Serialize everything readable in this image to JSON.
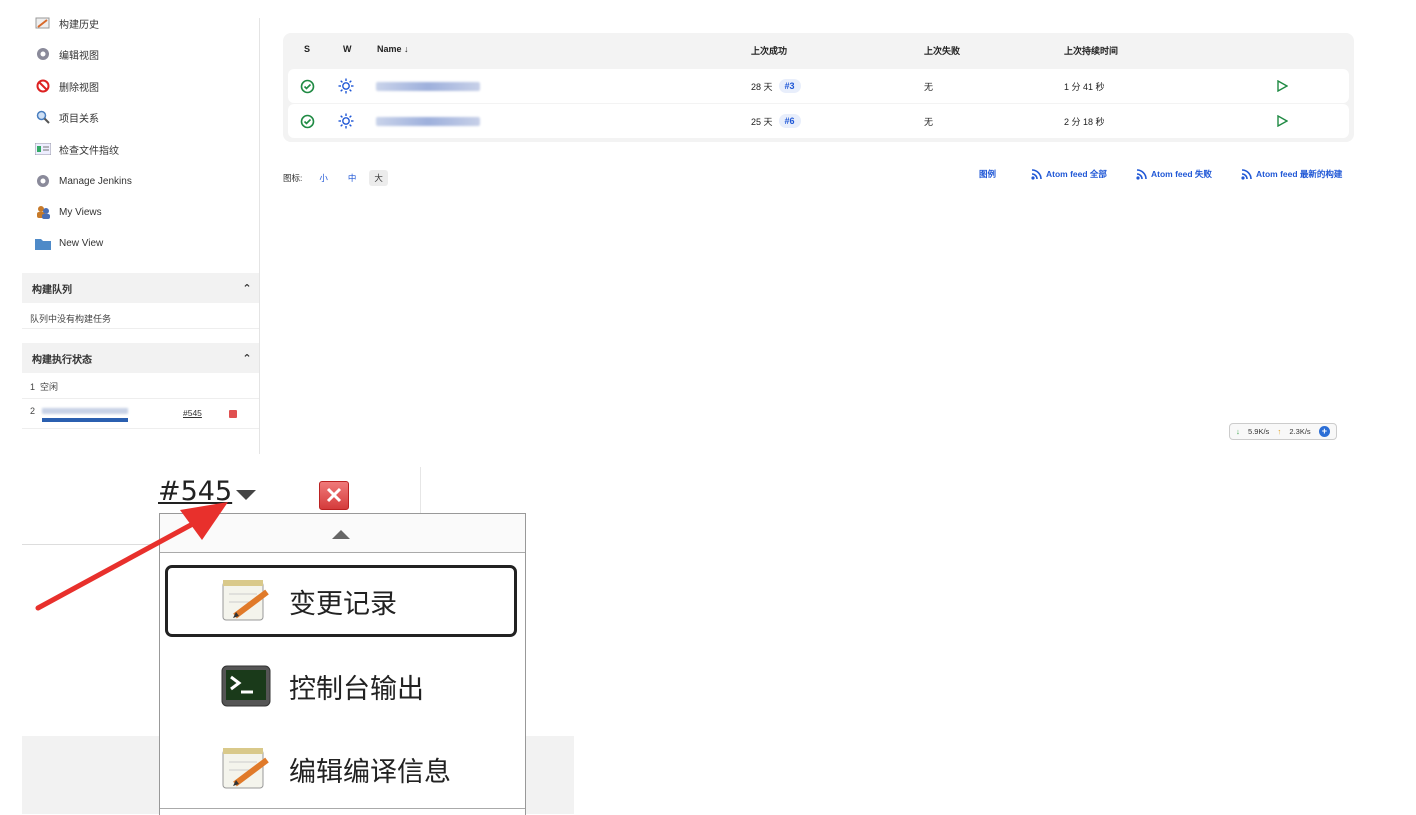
{
  "sidebar": {
    "tasks": [
      {
        "label": "构建历史",
        "icon": "notepad-icon"
      },
      {
        "label": "编辑视图",
        "icon": "gear-icon"
      },
      {
        "label": "删除视图",
        "icon": "no-entry-icon"
      },
      {
        "label": "项目关系",
        "icon": "search-icon"
      },
      {
        "label": "检查文件指纹",
        "icon": "fingerprint-icon"
      },
      {
        "label": "Manage Jenkins",
        "icon": "gear-icon"
      },
      {
        "label": "My Views",
        "icon": "users-icon"
      },
      {
        "label": "New View",
        "icon": "folder-icon"
      }
    ],
    "build_queue": {
      "title": "构建队列",
      "empty_text": "队列中没有构建任务"
    },
    "executor_status": {
      "title": "构建执行状态",
      "executors": [
        {
          "number": "1",
          "status": "空闲"
        },
        {
          "number": "2",
          "build": "#545"
        }
      ]
    }
  },
  "jobs_table": {
    "headers": {
      "s": "S",
      "w": "W",
      "name": "Name ↓",
      "last_success": "上次成功",
      "last_failure": "上次失败",
      "last_duration": "上次持续时间"
    },
    "rows": [
      {
        "last_success": "28 天",
        "success_build": "#3",
        "last_failure": "无",
        "last_duration": "1 分 41 秒"
      },
      {
        "last_success": "25 天",
        "success_build": "#6",
        "last_failure": "无",
        "last_duration": "2 分 18 秒"
      }
    ]
  },
  "footer": {
    "icon_label": "图标:",
    "sizes": [
      "小",
      "中",
      "大"
    ],
    "legend": "图例",
    "feeds": [
      "Atom feed 全部",
      "Atom feed 失败",
      "Atom feed 最新的构建"
    ]
  },
  "net_widget": {
    "down": "5.9K/s",
    "up": "2.3K/s"
  },
  "zoom": {
    "build_link": "#545",
    "menu": [
      "变更记录",
      "控制台输出",
      "编辑编译信息"
    ]
  },
  "colors": {
    "accent": "#1f57d6",
    "success": "#1f8a43",
    "arrow": "#e8302c"
  }
}
